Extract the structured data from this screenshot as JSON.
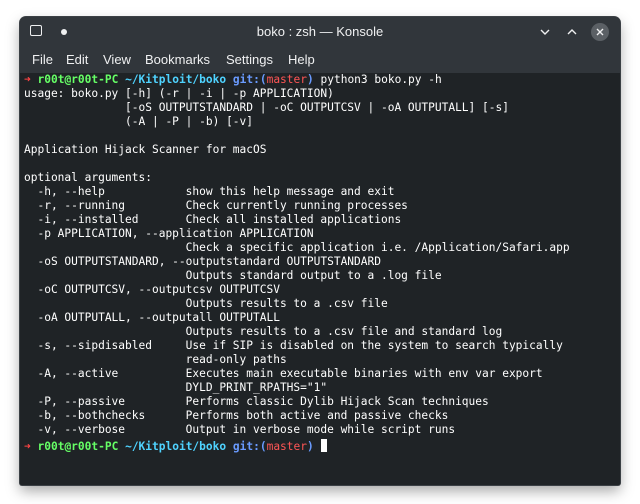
{
  "window": {
    "title": "boko : zsh — Konsole"
  },
  "menu": {
    "file": "File",
    "edit": "Edit",
    "view": "View",
    "bookmarks": "Bookmarks",
    "settings": "Settings",
    "help": "Help"
  },
  "prompt": {
    "arrow": "➜",
    "user": "r00t@r00t-PC",
    "path": "~/Kitploit/boko",
    "git_label": "git:",
    "paren_open": "(",
    "branch": "master",
    "paren_close": ")"
  },
  "command": "python3 boko.py -h",
  "output": [
    "usage: boko.py [-h] (-r | -i | -p APPLICATION)",
    "               [-oS OUTPUTSTANDARD | -oC OUTPUTCSV | -oA OUTPUTALL] [-s]",
    "               (-A | -P | -b) [-v]",
    "",
    "Application Hijack Scanner for macOS",
    "",
    "optional arguments:",
    "  -h, --help            show this help message and exit",
    "  -r, --running         Check currently running processes",
    "  -i, --installed       Check all installed applications",
    "  -p APPLICATION, --application APPLICATION",
    "                        Check a specific application i.e. /Application/Safari.app",
    "  -oS OUTPUTSTANDARD, --outputstandard OUTPUTSTANDARD",
    "                        Outputs standard output to a .log file",
    "  -oC OUTPUTCSV, --outputcsv OUTPUTCSV",
    "                        Outputs results to a .csv file",
    "  -oA OUTPUTALL, --outputall OUTPUTALL",
    "                        Outputs results to a .csv file and standard log",
    "  -s, --sipdisabled     Use if SIP is disabled on the system to search typically",
    "                        read-only paths",
    "  -A, --active          Executes main executable binaries with env var export",
    "                        DYLD_PRINT_RPATHS=\"1\"",
    "  -P, --passive         Performs classic Dylib Hijack Scan techniques",
    "  -b, --bothchecks      Performs both active and passive checks",
    "  -v, --verbose         Output in verbose mode while script runs"
  ],
  "colors": {
    "arrow": "#ff4444",
    "user": "#66ff66",
    "path": "#4fd3ff",
    "git": "#6a9bff",
    "branch": "#ff5555",
    "background": "#1f2326",
    "chrome": "#31363b"
  },
  "icons": {
    "app": "konsole-app-icon",
    "pin": "pin-icon",
    "minimize": "minimize-icon",
    "maximize": "maximize-icon",
    "close": "close-icon"
  }
}
